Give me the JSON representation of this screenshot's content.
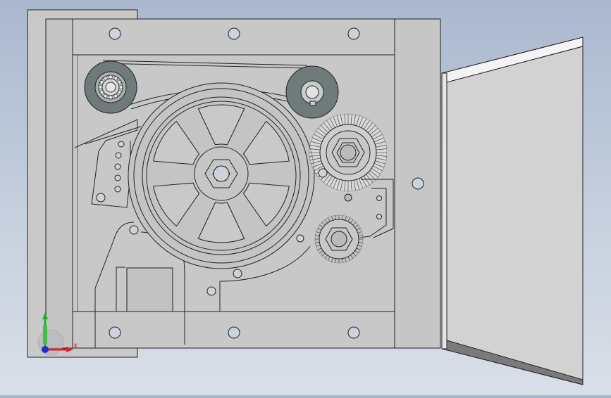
{
  "viewport": {
    "background_top": "#aab8cf",
    "background_bottom": "#d9dfe8",
    "part_fill": "#c8c8c8",
    "part_fill_dark": "#bdbdbd",
    "edge_color": "#222222",
    "pulley_color": "#6f7a7a"
  },
  "triad": {
    "x_label": "X",
    "y_label": "Y",
    "x_color": "#e02020",
    "y_color": "#20b020",
    "z_color": "#2030d0"
  }
}
